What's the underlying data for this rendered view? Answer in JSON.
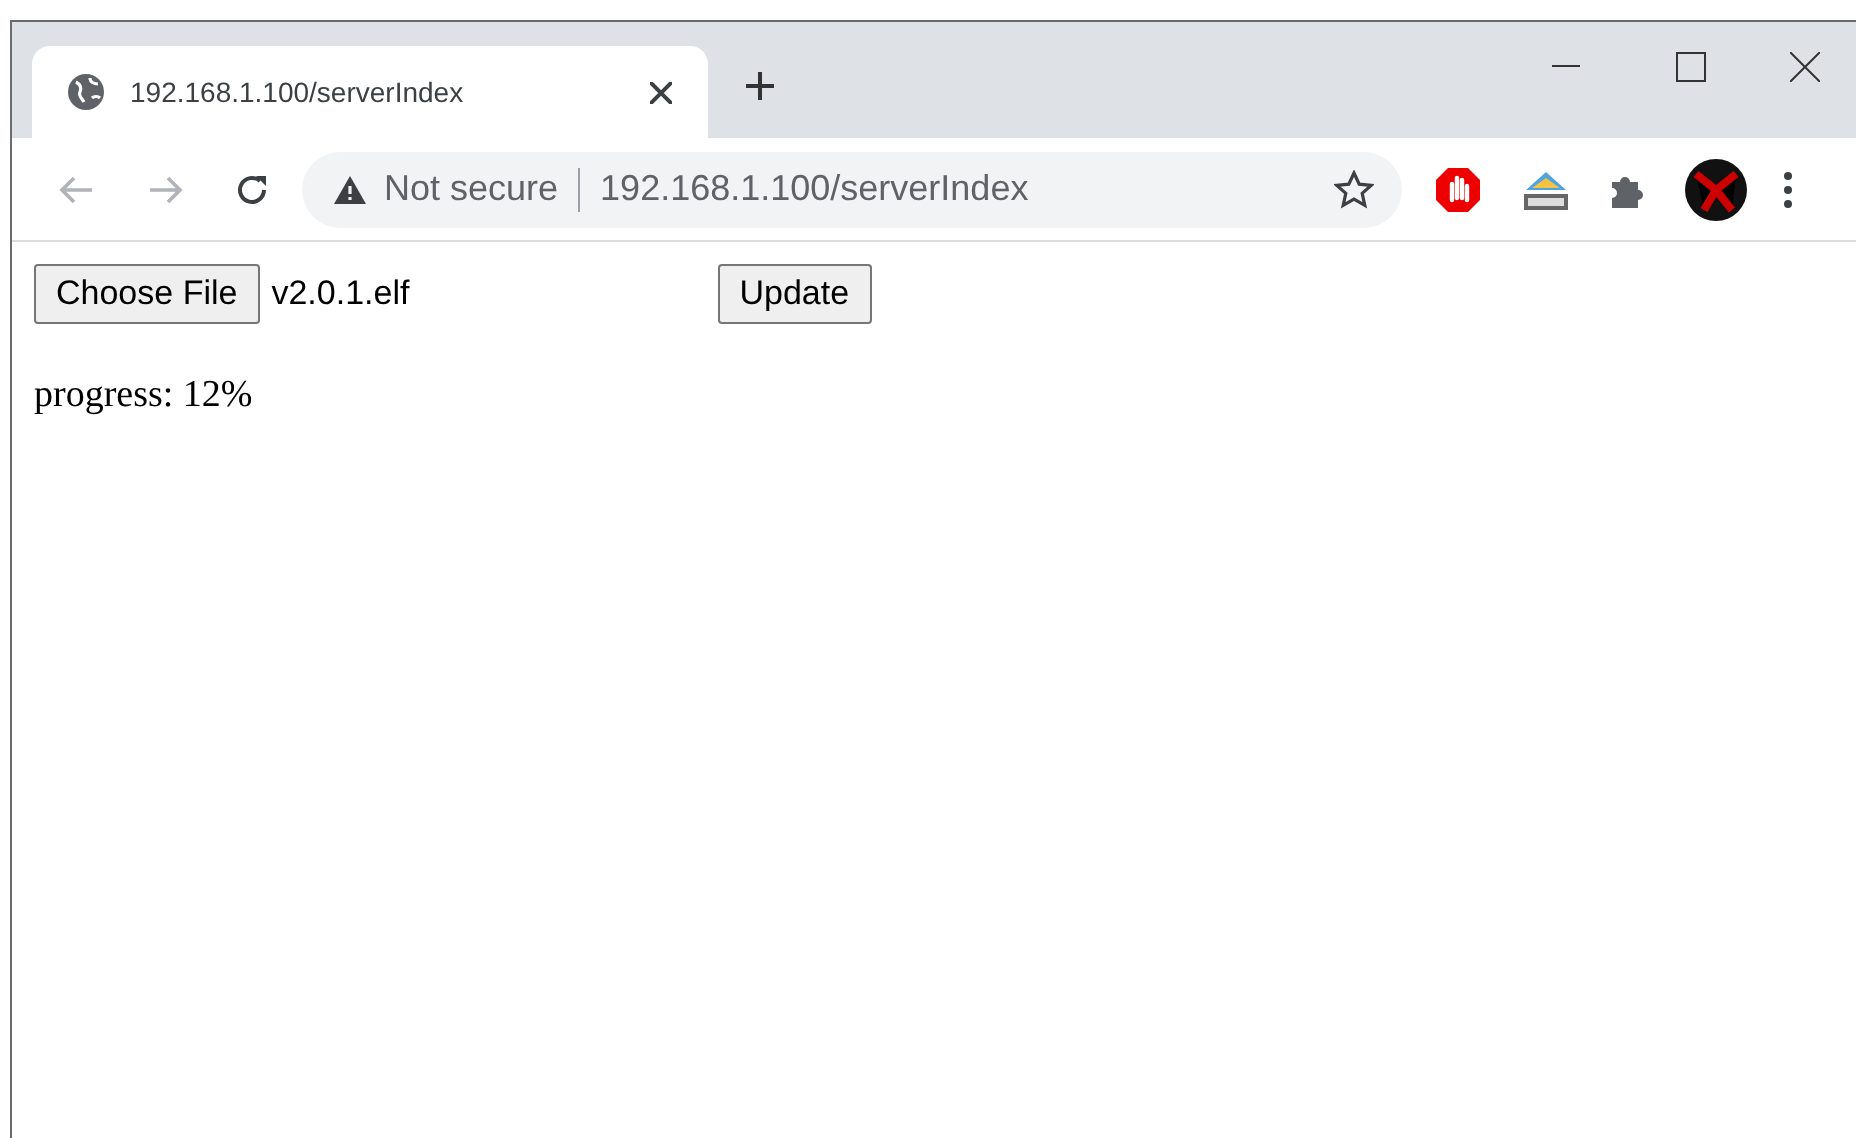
{
  "tabs": [
    {
      "title": "192.168.1.100/serverIndex",
      "selected": true
    }
  ],
  "address_bar": {
    "security": "Not secure",
    "url": "192.168.1.100/serverIndex"
  },
  "page": {
    "file_button": "Choose File",
    "file_name": "v2.0.1.elf",
    "submit_button": "Update",
    "progress": "progress: 12%"
  }
}
